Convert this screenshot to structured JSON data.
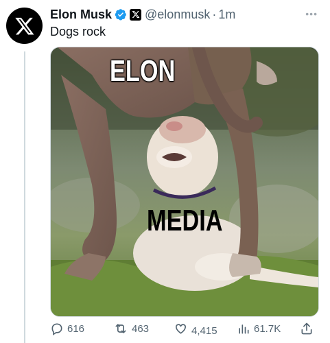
{
  "author": {
    "name": "Elon Musk",
    "handle": "@elonmusk",
    "separator": "·",
    "time": "1m",
    "verified": true
  },
  "tweet": {
    "text": "Dogs rock"
  },
  "media": {
    "top_caption": "ELON",
    "bottom_caption": "MEDIA"
  },
  "actions": {
    "replies": "616",
    "reposts": "463",
    "likes": "4,415",
    "views": "61.7K"
  },
  "icons": [
    "x-logo-icon",
    "verified-badge-icon",
    "x-affiliate-badge-icon",
    "more-options-icon",
    "reply-icon",
    "repost-icon",
    "like-icon",
    "views-icon",
    "share-icon"
  ],
  "colors": {
    "verified": "#1d9bf0",
    "secondary_text": "#536471"
  }
}
